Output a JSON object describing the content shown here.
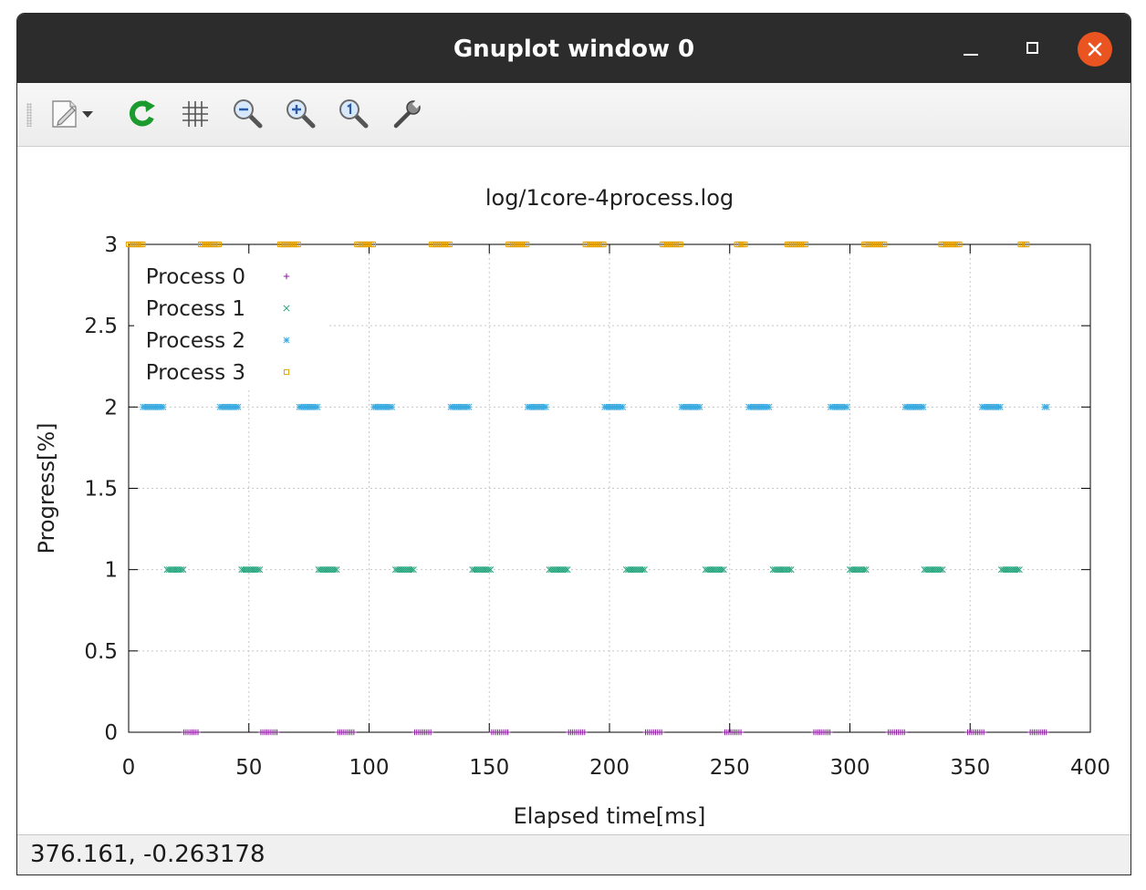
{
  "window": {
    "title": "Gnuplot window 0"
  },
  "toolbar": {
    "items": [
      {
        "name": "export-icon",
        "tooltip": ""
      },
      {
        "name": "replot-icon"
      },
      {
        "name": "grid-icon"
      },
      {
        "name": "zoom-out-icon"
      },
      {
        "name": "zoom-in-icon"
      },
      {
        "name": "zoom-reset-icon"
      },
      {
        "name": "settings-icon"
      }
    ]
  },
  "status": {
    "coordinates": "376.161, -0.263178"
  },
  "chart_data": {
    "type": "scatter",
    "title": "log/1core-4process.log",
    "xlabel": "Elapsed time[ms]",
    "ylabel": "Progress[%]",
    "xlim": [
      0,
      400
    ],
    "ylim": [
      0,
      3
    ],
    "xticks": [
      "0",
      "50",
      "100",
      "150",
      "200",
      "250",
      "300",
      "350",
      "400"
    ],
    "yticks": [
      "0",
      "0.5",
      "1",
      "1.5",
      "2",
      "2.5",
      "3"
    ],
    "grid": true,
    "legend_position": "top-left",
    "series": [
      {
        "name": "Process 0",
        "marker": "+",
        "color": "#8b1a9e",
        "y": 0,
        "segments": [
          [
            23,
            29
          ],
          [
            55,
            62
          ],
          [
            87,
            94
          ],
          [
            119,
            126
          ],
          [
            151,
            158
          ],
          [
            183,
            190
          ],
          [
            215,
            222
          ],
          [
            248,
            255
          ],
          [
            285,
            292
          ],
          [
            316,
            323
          ],
          [
            349,
            356
          ],
          [
            375,
            382
          ]
        ]
      },
      {
        "name": "Process 1",
        "marker": "x",
        "color": "#1fa37a",
        "y": 1,
        "segments": [
          [
            16,
            23
          ],
          [
            47,
            55
          ],
          [
            79,
            87
          ],
          [
            111,
            119
          ],
          [
            143,
            151
          ],
          [
            175,
            183
          ],
          [
            207,
            215
          ],
          [
            240,
            248
          ],
          [
            268,
            276
          ],
          [
            300,
            307
          ],
          [
            331,
            339
          ],
          [
            363,
            371
          ]
        ]
      },
      {
        "name": "Process 2",
        "marker": "*",
        "color": "#3aaae0",
        "y": 2,
        "segments": [
          [
            6,
            15
          ],
          [
            38,
            46
          ],
          [
            71,
            79
          ],
          [
            102,
            110
          ],
          [
            134,
            142
          ],
          [
            166,
            174
          ],
          [
            198,
            206
          ],
          [
            230,
            238
          ],
          [
            258,
            267
          ],
          [
            292,
            299
          ],
          [
            323,
            331
          ],
          [
            355,
            363
          ],
          [
            381,
            382
          ]
        ]
      },
      {
        "name": "Process 3",
        "marker": "square",
        "color": "#e3a000",
        "y": 3,
        "segments": [
          [
            0,
            6
          ],
          [
            30,
            38
          ],
          [
            63,
            71
          ],
          [
            95,
            102
          ],
          [
            126,
            134
          ],
          [
            158,
            166
          ],
          [
            190,
            198
          ],
          [
            222,
            230
          ],
          [
            253,
            257
          ],
          [
            274,
            282
          ],
          [
            306,
            315
          ],
          [
            338,
            346
          ],
          [
            371,
            374
          ]
        ]
      }
    ]
  }
}
